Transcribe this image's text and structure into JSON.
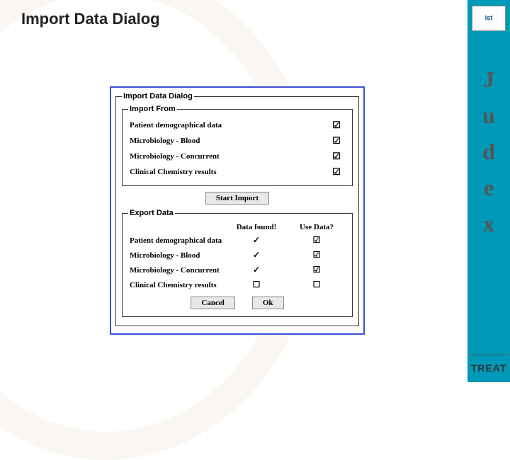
{
  "page_title": "Import Data Dialog",
  "sidebar": {
    "logo_text": "ist",
    "brand_letters": [
      "J",
      "u",
      "d",
      "e",
      "x"
    ],
    "footer_brand": "TREAT"
  },
  "dialog": {
    "title": "Import Data Dialog",
    "import_from": {
      "legend": "Import From",
      "rows": [
        {
          "label": "Patient demographical data",
          "checked": true
        },
        {
          "label": "Microbiology - Blood",
          "checked": true
        },
        {
          "label": "Microbiology - Concurrent",
          "checked": true
        },
        {
          "label": "Clinical Chemistry results",
          "checked": true
        }
      ]
    },
    "start_import_label": "Start Import",
    "export_data": {
      "legend": "Export Data",
      "header_found": "Data found!",
      "header_use": "Use Data?",
      "rows": [
        {
          "label": "Patient demographical data",
          "found": "✓",
          "use": "☑"
        },
        {
          "label": "Microbiology - Blood",
          "found": "✓",
          "use": "☑"
        },
        {
          "label": "Microbiology - Concurrent",
          "found": "✓",
          "use": "☑"
        },
        {
          "label": "Clinical Chemistry results",
          "found": "☐",
          "use": "☐"
        }
      ]
    },
    "cancel_label": "Cancel",
    "ok_label": "Ok"
  }
}
